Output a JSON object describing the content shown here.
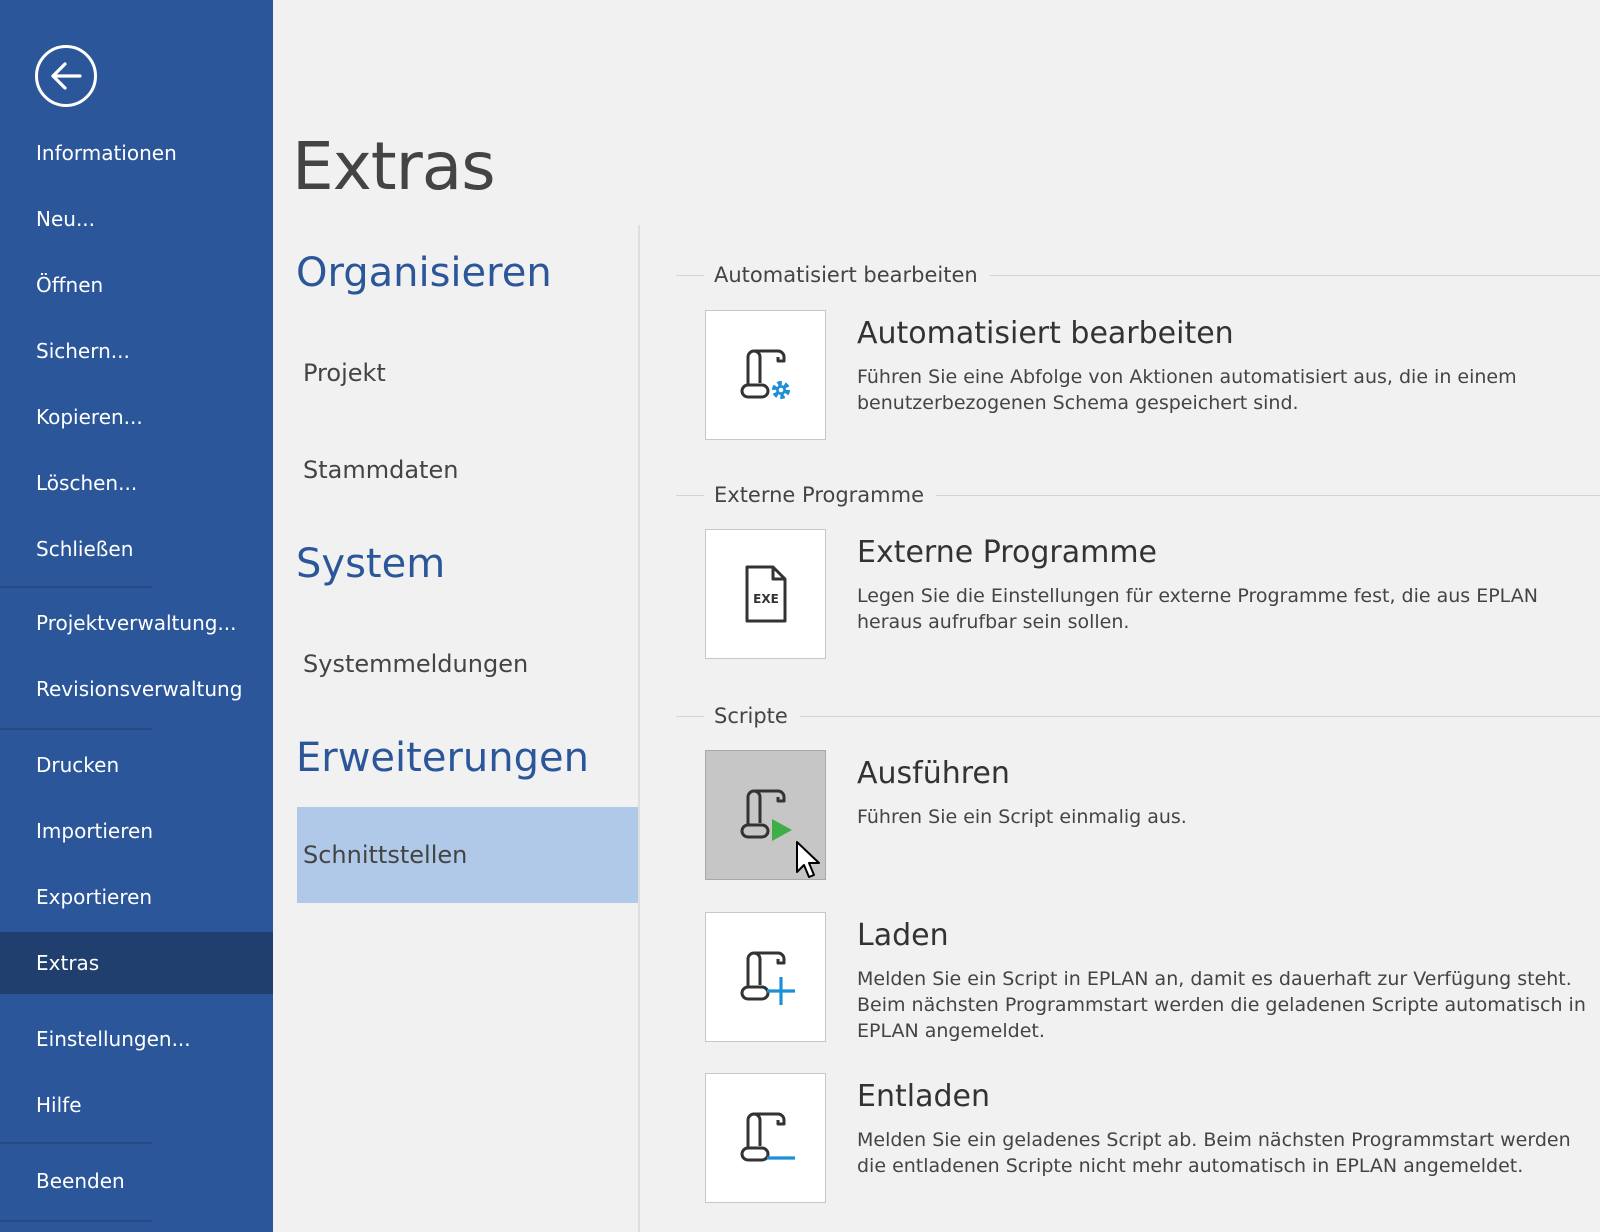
{
  "nav": {
    "items": [
      {
        "label": "Informationen"
      },
      {
        "label": "Neu..."
      },
      {
        "label": "Öffnen"
      },
      {
        "label": "Sichern..."
      },
      {
        "label": "Kopieren..."
      },
      {
        "label": "Löschen..."
      },
      {
        "label": "Schließen"
      },
      {
        "label": "Projektverwaltung..."
      },
      {
        "label": "Revisionsverwaltung"
      },
      {
        "label": "Drucken"
      },
      {
        "label": "Importieren"
      },
      {
        "label": "Exportieren"
      },
      {
        "label": "Extras"
      },
      {
        "label": "Einstellungen..."
      },
      {
        "label": "Hilfe"
      },
      {
        "label": "Beenden"
      }
    ],
    "active": "Extras"
  },
  "page": {
    "title": "Extras"
  },
  "categories": {
    "organize": {
      "heading": "Organisieren",
      "items": [
        {
          "label": "Projekt"
        },
        {
          "label": "Stammdaten"
        }
      ]
    },
    "system": {
      "heading": "System",
      "items": [
        {
          "label": "Systemmeldungen"
        }
      ]
    },
    "extensions": {
      "heading": "Erweiterungen",
      "items": [
        {
          "label": "Schnittstellen"
        }
      ]
    },
    "selected": "Schnittstellen"
  },
  "groups": {
    "automation": {
      "title": "Automatisiert bearbeiten",
      "actions": [
        {
          "title": "Automatisiert bearbeiten",
          "description": "Führen Sie eine Abfolge von Aktionen automatisiert aus, die in einem benutzerbezogenen Schema gespeichert sind.",
          "icon": "script-gear-icon"
        }
      ]
    },
    "external": {
      "title": "Externe Programme",
      "actions": [
        {
          "title": "Externe Programme",
          "description": "Legen Sie die Einstellungen für externe Programme fest, die aus EPLAN heraus aufrufbar sein sollen.",
          "icon": "exe-file-icon",
          "icon_text": "EXE"
        }
      ]
    },
    "scripts": {
      "title": "Scripte",
      "actions": [
        {
          "title": "Ausführen",
          "description": "Führen Sie ein Script einmalig aus.",
          "icon": "script-run-icon"
        },
        {
          "title": "Laden",
          "description": "Melden Sie ein Script in EPLAN an, damit es dauerhaft zur Verfügung steht. Beim nächsten Programmstart werden die geladenen Scripte automatisch in EPLAN angemeldet.",
          "icon": "script-load-icon"
        },
        {
          "title": "Entladen",
          "description": "Melden Sie ein geladenes Script ab. Beim nächsten Programmstart werden die entladenen Scripte nicht mehr automatisch in EPLAN angemeldet.",
          "icon": "script-unload-icon"
        }
      ]
    }
  },
  "colors": {
    "nav_bg": "#2b579a",
    "nav_active": "#203f6f",
    "heading_blue": "#2b579a",
    "selected_bg": "#b1c9e8",
    "gear_blue": "#1e8fd6",
    "run_green": "#3fae49",
    "add_blue": "#1e8fd6"
  }
}
